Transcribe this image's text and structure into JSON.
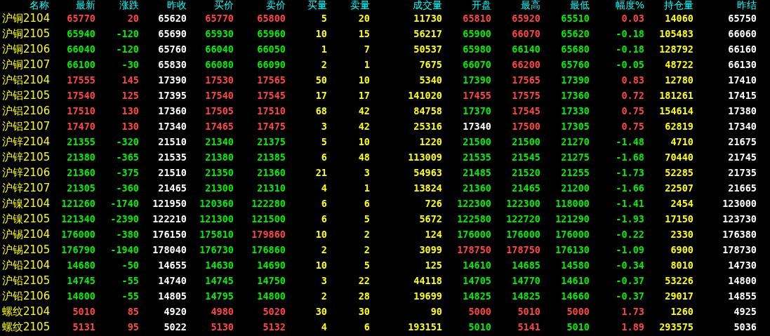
{
  "table": {
    "columns": [
      {
        "label": "名称",
        "kind": "name"
      },
      {
        "label": "最新",
        "kind": "price"
      },
      {
        "label": "涨跌",
        "kind": "change"
      },
      {
        "label": "昨收",
        "kind": "plain"
      },
      {
        "label": "买价",
        "kind": "price"
      },
      {
        "label": "卖价",
        "kind": "price"
      },
      {
        "label": "买量",
        "kind": "volume"
      },
      {
        "label": "卖量",
        "kind": "volume"
      },
      {
        "label": "成交量",
        "kind": "volume"
      },
      {
        "label": "开盘",
        "kind": "price"
      },
      {
        "label": "最高",
        "kind": "price"
      },
      {
        "label": "最低",
        "kind": "price"
      },
      {
        "label": "幅度%",
        "kind": "change"
      },
      {
        "label": "持仓量",
        "kind": "volume"
      },
      {
        "label": "昨结",
        "kind": "reference"
      }
    ],
    "rows": [
      [
        "沪铜2104",
        "65770",
        "20",
        "65620",
        "65770",
        "65800",
        "5",
        "20",
        "11730",
        "65810",
        "65920",
        "65510",
        "0.03",
        "14060",
        "65750"
      ],
      [
        "沪铜2105",
        "65940",
        "-120",
        "65690",
        "65930",
        "65960",
        "10",
        "15",
        "56217",
        "65900",
        "66070",
        "65620",
        "-0.18",
        "105483",
        "66060"
      ],
      [
        "沪铜2106",
        "66040",
        "-120",
        "65760",
        "66040",
        "66050",
        "1",
        "7",
        "50537",
        "65980",
        "66140",
        "65680",
        "-0.18",
        "128792",
        "66160"
      ],
      [
        "沪铜2107",
        "66100",
        "-30",
        "65830",
        "66080",
        "66090",
        "2",
        "1",
        "7675",
        "66070",
        "66200",
        "65760",
        "-0.05",
        "48722",
        "66130"
      ],
      [
        "沪铝2104",
        "17555",
        "145",
        "17390",
        "17530",
        "17565",
        "50",
        "10",
        "5340",
        "17390",
        "17565",
        "17390",
        "0.83",
        "12780",
        "17410"
      ],
      [
        "沪铝2105",
        "17540",
        "125",
        "17395",
        "17540",
        "17545",
        "17",
        "17",
        "141020",
        "17455",
        "17575",
        "17360",
        "0.72",
        "181261",
        "17415"
      ],
      [
        "沪铝2106",
        "17510",
        "130",
        "17360",
        "17505",
        "17510",
        "68",
        "42",
        "84758",
        "17370",
        "17545",
        "17330",
        "0.75",
        "154614",
        "17380"
      ],
      [
        "沪铝2107",
        "17470",
        "130",
        "17340",
        "17465",
        "17475",
        "3",
        "42",
        "25316",
        "17340",
        "17500",
        "17305",
        "0.75",
        "62819",
        "17340"
      ],
      [
        "沪锌2104",
        "21355",
        "-320",
        "21510",
        "21340",
        "21375",
        "5",
        "10",
        "1220",
        "21500",
        "21500",
        "21270",
        "-1.48",
        "4710",
        "21675"
      ],
      [
        "沪锌2105",
        "21380",
        "-365",
        "21535",
        "21380",
        "21385",
        "6",
        "48",
        "113009",
        "21535",
        "21545",
        "21275",
        "-1.68",
        "70440",
        "21745"
      ],
      [
        "沪锌2106",
        "21360",
        "-375",
        "21510",
        "21350",
        "21360",
        "21",
        "3",
        "54963",
        "21485",
        "21520",
        "21255",
        "-1.73",
        "52285",
        "21735"
      ],
      [
        "沪锌2107",
        "21305",
        "-360",
        "21465",
        "21300",
        "21310",
        "4",
        "1",
        "13824",
        "21360",
        "21465",
        "21200",
        "-1.66",
        "22507",
        "21665"
      ],
      [
        "沪镍2104",
        "121260",
        "-1740",
        "121950",
        "120360",
        "122280",
        "6",
        "6",
        "726",
        "122300",
        "122300",
        "118000",
        "-1.41",
        "2454",
        "123000"
      ],
      [
        "沪镍2105",
        "121340",
        "-2390",
        "122210",
        "121300",
        "121500",
        "6",
        "5",
        "5672",
        "122580",
        "122720",
        "121290",
        "-1.93",
        "17150",
        "123730"
      ],
      [
        "沪锡2104",
        "176000",
        "-380",
        "176150",
        "175810",
        "179860",
        "10",
        "2",
        "124",
        "176000",
        "176000",
        "176000",
        "-0.22",
        "2330",
        "176380"
      ],
      [
        "沪锡2105",
        "176790",
        "-1940",
        "178040",
        "176730",
        "176860",
        "2",
        "2",
        "3099",
        "178750",
        "178750",
        "176130",
        "-1.09",
        "6900",
        "178730"
      ],
      [
        "沪铅2104",
        "14680",
        "-50",
        "14655",
        "14630",
        "14690",
        "10",
        "5",
        "125",
        "14610",
        "14685",
        "14580",
        "-0.34",
        "8010",
        "14730"
      ],
      [
        "沪铅2105",
        "14745",
        "-55",
        "14740",
        "14745",
        "14750",
        "3",
        "22",
        "44118",
        "14705",
        "14770",
        "14610",
        "-0.37",
        "53226",
        "14800"
      ],
      [
        "沪铅2106",
        "14800",
        "-55",
        "14805",
        "14795",
        "14800",
        "2",
        "28",
        "19699",
        "14825",
        "14825",
        "14660",
        "-0.37",
        "29017",
        "14855"
      ],
      [
        "螺纹2104",
        "5010",
        "85",
        "4920",
        "4980",
        "5020",
        "30",
        "30",
        "90",
        "5000",
        "5010",
        "5000",
        "1.73",
        "1260",
        "4925"
      ],
      [
        "螺纹2105",
        "5131",
        "95",
        "5022",
        "5130",
        "5132",
        "4",
        "6",
        "193151",
        "5010",
        "5141",
        "5010",
        "1.89",
        "293575",
        "5036"
      ]
    ]
  }
}
